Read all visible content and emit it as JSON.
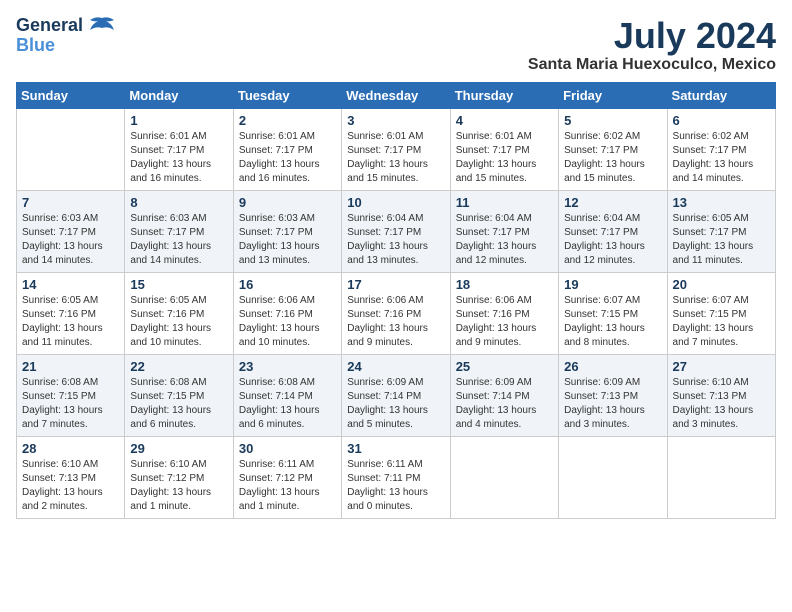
{
  "header": {
    "logo_line1": "General",
    "logo_line2": "Blue",
    "month_title": "July 2024",
    "location": "Santa Maria Huexoculco, Mexico"
  },
  "days_of_week": [
    "Sunday",
    "Monday",
    "Tuesday",
    "Wednesday",
    "Thursday",
    "Friday",
    "Saturday"
  ],
  "weeks": [
    [
      {
        "day": "",
        "info": ""
      },
      {
        "day": "1",
        "info": "Sunrise: 6:01 AM\nSunset: 7:17 PM\nDaylight: 13 hours\nand 16 minutes."
      },
      {
        "day": "2",
        "info": "Sunrise: 6:01 AM\nSunset: 7:17 PM\nDaylight: 13 hours\nand 16 minutes."
      },
      {
        "day": "3",
        "info": "Sunrise: 6:01 AM\nSunset: 7:17 PM\nDaylight: 13 hours\nand 15 minutes."
      },
      {
        "day": "4",
        "info": "Sunrise: 6:01 AM\nSunset: 7:17 PM\nDaylight: 13 hours\nand 15 minutes."
      },
      {
        "day": "5",
        "info": "Sunrise: 6:02 AM\nSunset: 7:17 PM\nDaylight: 13 hours\nand 15 minutes."
      },
      {
        "day": "6",
        "info": "Sunrise: 6:02 AM\nSunset: 7:17 PM\nDaylight: 13 hours\nand 14 minutes."
      }
    ],
    [
      {
        "day": "7",
        "info": "Sunrise: 6:03 AM\nSunset: 7:17 PM\nDaylight: 13 hours\nand 14 minutes."
      },
      {
        "day": "8",
        "info": "Sunrise: 6:03 AM\nSunset: 7:17 PM\nDaylight: 13 hours\nand 14 minutes."
      },
      {
        "day": "9",
        "info": "Sunrise: 6:03 AM\nSunset: 7:17 PM\nDaylight: 13 hours\nand 13 minutes."
      },
      {
        "day": "10",
        "info": "Sunrise: 6:04 AM\nSunset: 7:17 PM\nDaylight: 13 hours\nand 13 minutes."
      },
      {
        "day": "11",
        "info": "Sunrise: 6:04 AM\nSunset: 7:17 PM\nDaylight: 13 hours\nand 12 minutes."
      },
      {
        "day": "12",
        "info": "Sunrise: 6:04 AM\nSunset: 7:17 PM\nDaylight: 13 hours\nand 12 minutes."
      },
      {
        "day": "13",
        "info": "Sunrise: 6:05 AM\nSunset: 7:17 PM\nDaylight: 13 hours\nand 11 minutes."
      }
    ],
    [
      {
        "day": "14",
        "info": "Sunrise: 6:05 AM\nSunset: 7:16 PM\nDaylight: 13 hours\nand 11 minutes."
      },
      {
        "day": "15",
        "info": "Sunrise: 6:05 AM\nSunset: 7:16 PM\nDaylight: 13 hours\nand 10 minutes."
      },
      {
        "day": "16",
        "info": "Sunrise: 6:06 AM\nSunset: 7:16 PM\nDaylight: 13 hours\nand 10 minutes."
      },
      {
        "day": "17",
        "info": "Sunrise: 6:06 AM\nSunset: 7:16 PM\nDaylight: 13 hours\nand 9 minutes."
      },
      {
        "day": "18",
        "info": "Sunrise: 6:06 AM\nSunset: 7:16 PM\nDaylight: 13 hours\nand 9 minutes."
      },
      {
        "day": "19",
        "info": "Sunrise: 6:07 AM\nSunset: 7:15 PM\nDaylight: 13 hours\nand 8 minutes."
      },
      {
        "day": "20",
        "info": "Sunrise: 6:07 AM\nSunset: 7:15 PM\nDaylight: 13 hours\nand 7 minutes."
      }
    ],
    [
      {
        "day": "21",
        "info": "Sunrise: 6:08 AM\nSunset: 7:15 PM\nDaylight: 13 hours\nand 7 minutes."
      },
      {
        "day": "22",
        "info": "Sunrise: 6:08 AM\nSunset: 7:15 PM\nDaylight: 13 hours\nand 6 minutes."
      },
      {
        "day": "23",
        "info": "Sunrise: 6:08 AM\nSunset: 7:14 PM\nDaylight: 13 hours\nand 6 minutes."
      },
      {
        "day": "24",
        "info": "Sunrise: 6:09 AM\nSunset: 7:14 PM\nDaylight: 13 hours\nand 5 minutes."
      },
      {
        "day": "25",
        "info": "Sunrise: 6:09 AM\nSunset: 7:14 PM\nDaylight: 13 hours\nand 4 minutes."
      },
      {
        "day": "26",
        "info": "Sunrise: 6:09 AM\nSunset: 7:13 PM\nDaylight: 13 hours\nand 3 minutes."
      },
      {
        "day": "27",
        "info": "Sunrise: 6:10 AM\nSunset: 7:13 PM\nDaylight: 13 hours\nand 3 minutes."
      }
    ],
    [
      {
        "day": "28",
        "info": "Sunrise: 6:10 AM\nSunset: 7:13 PM\nDaylight: 13 hours\nand 2 minutes."
      },
      {
        "day": "29",
        "info": "Sunrise: 6:10 AM\nSunset: 7:12 PM\nDaylight: 13 hours\nand 1 minute."
      },
      {
        "day": "30",
        "info": "Sunrise: 6:11 AM\nSunset: 7:12 PM\nDaylight: 13 hours\nand 1 minute."
      },
      {
        "day": "31",
        "info": "Sunrise: 6:11 AM\nSunset: 7:11 PM\nDaylight: 13 hours\nand 0 minutes."
      },
      {
        "day": "",
        "info": ""
      },
      {
        "day": "",
        "info": ""
      },
      {
        "day": "",
        "info": ""
      }
    ]
  ]
}
